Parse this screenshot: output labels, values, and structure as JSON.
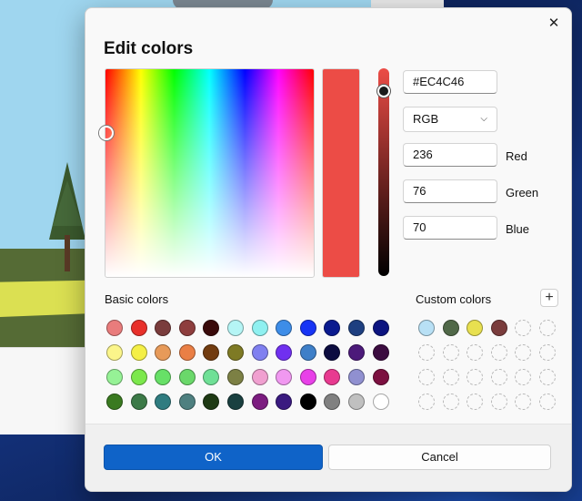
{
  "dialog": {
    "title": "Edit colors",
    "close_icon": "close-icon",
    "current_color": "#EC4C46"
  },
  "picker": {
    "hex_value": "#EC4C46",
    "mode": "RGB",
    "brightness_level": 0.92
  },
  "channels": [
    {
      "value": "236",
      "label": "Red"
    },
    {
      "value": "76",
      "label": "Green"
    },
    {
      "value": "70",
      "label": "Blue"
    }
  ],
  "basic_colors": {
    "label": "Basic colors",
    "swatches": [
      "#E97C7C",
      "#E8302A",
      "#7A3C3C",
      "#8E3E3E",
      "#3A0A0A",
      "#B5F5F5",
      "#8FF0F0",
      "#3D8DE8",
      "#1734F5",
      "#0A1A8F",
      "#1E3F80",
      "#0C1480",
      "#FBF58A",
      "#F4EF46",
      "#E79A59",
      "#EA7F45",
      "#723C10",
      "#7E7A24",
      "#8080F0",
      "#7030F0",
      "#3E7FC8",
      "#0C0C40",
      "#4C1A7A",
      "#3C0C40",
      "#96F296",
      "#7CE84C",
      "#67E067",
      "#6AD86A",
      "#6FE096",
      "#7C8044",
      "#F0A0D0",
      "#F098F0",
      "#E840E8",
      "#E83A90",
      "#9090D0",
      "#7C1040",
      "#3A7A20",
      "#3C7A48",
      "#2F7C80",
      "#4E8080",
      "#1E3A14",
      "#1A4040",
      "#7C1C80",
      "#3A1A80",
      "#000000",
      "#808080",
      "#C0C0C0",
      "#FFFFFF"
    ]
  },
  "custom_colors": {
    "label": "Custom colors",
    "add_icon": "plus-icon",
    "filled": [
      "#B8E0F5",
      "#506848",
      "#E8E050",
      "#7A3C3C"
    ],
    "empty_slots": 20
  },
  "footer": {
    "ok_label": "OK",
    "cancel_label": "Cancel"
  }
}
